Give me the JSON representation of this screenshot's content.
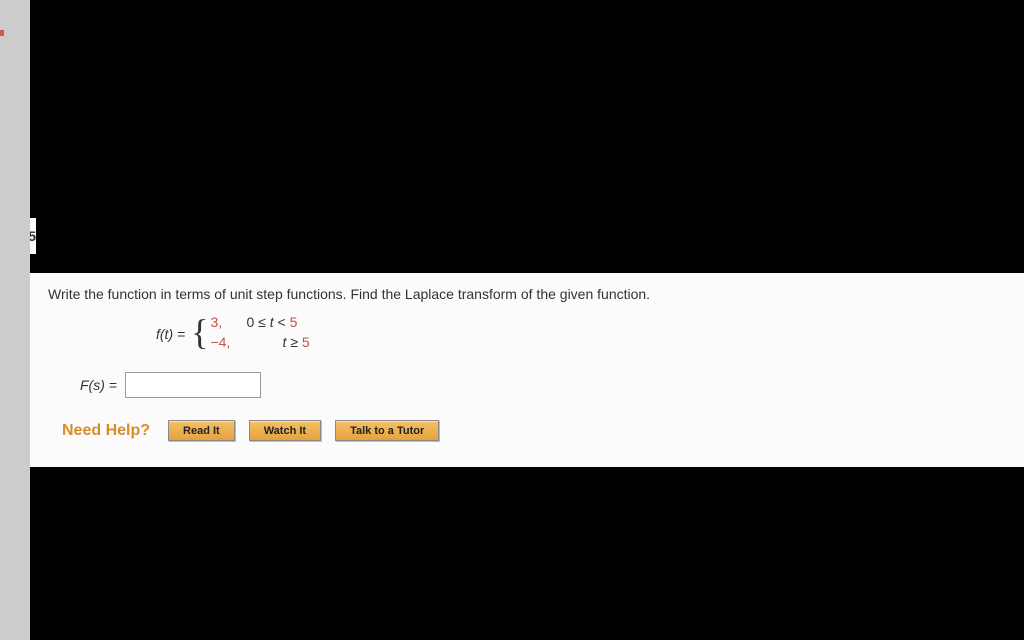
{
  "nub_digit": "5",
  "prompt": "Write the function in terms of unit step functions. Find the Laplace transform of the given function.",
  "function_label": "f(t) = ",
  "cases": [
    {
      "value": "3,",
      "cond_prefix": "0 ≤ ",
      "cond_var": "t",
      "cond_mid": " < ",
      "cond_bound": "5"
    },
    {
      "value": "−4,",
      "cond_prefix": "",
      "cond_var": "t",
      "cond_mid": " ≥ ",
      "cond_bound": "5"
    }
  ],
  "answer_label": "F(s) =",
  "answer_value": "",
  "help": {
    "label": "Need Help?",
    "buttons": [
      "Read It",
      "Watch It",
      "Talk to a Tutor"
    ]
  }
}
